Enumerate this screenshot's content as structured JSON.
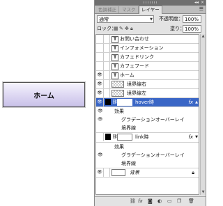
{
  "canvas": {
    "button_label": "ホーム"
  },
  "panel": {
    "tabs": [
      "色調補正",
      "マスク",
      "レイヤー"
    ],
    "active_tab": 2,
    "blend_mode": "通常",
    "opacity_label": "不透明度：",
    "opacity_value": "100%",
    "lock_label": "ロック：",
    "fill_label": "塗り：",
    "fill_value": "100%"
  },
  "layers": [
    {
      "name": "お問い合わせ",
      "kind": "text",
      "visible": false
    },
    {
      "name": "インフォメーション",
      "kind": "text",
      "visible": false
    },
    {
      "name": "カフェドリンク",
      "kind": "text",
      "visible": false
    },
    {
      "name": "カフェフード",
      "kind": "text",
      "visible": false
    },
    {
      "name": "ホーム",
      "kind": "text",
      "visible": true
    },
    {
      "name": "境界線右",
      "kind": "shape",
      "visible": true
    },
    {
      "name": "境界線左",
      "kind": "shape",
      "visible": true
    },
    {
      "name": "hover時",
      "kind": "shape",
      "visible": true,
      "selected": true,
      "fx": "fx"
    },
    {
      "effects_label": "効果",
      "effects": [
        "グラデーションオーバーレイ",
        "境界線"
      ]
    },
    {
      "name": "link時",
      "kind": "shape",
      "visible": false,
      "fx": "fx"
    },
    {
      "effects_label": "効果",
      "effects": [
        "グラデーションオーバーレイ",
        "境界線"
      ]
    },
    {
      "name": "背景",
      "kind": "bg",
      "visible": true
    }
  ],
  "colors": {
    "selected": "#3a66c6",
    "button_top": "#f6f4fd",
    "button_bottom": "#c9c1e8"
  }
}
